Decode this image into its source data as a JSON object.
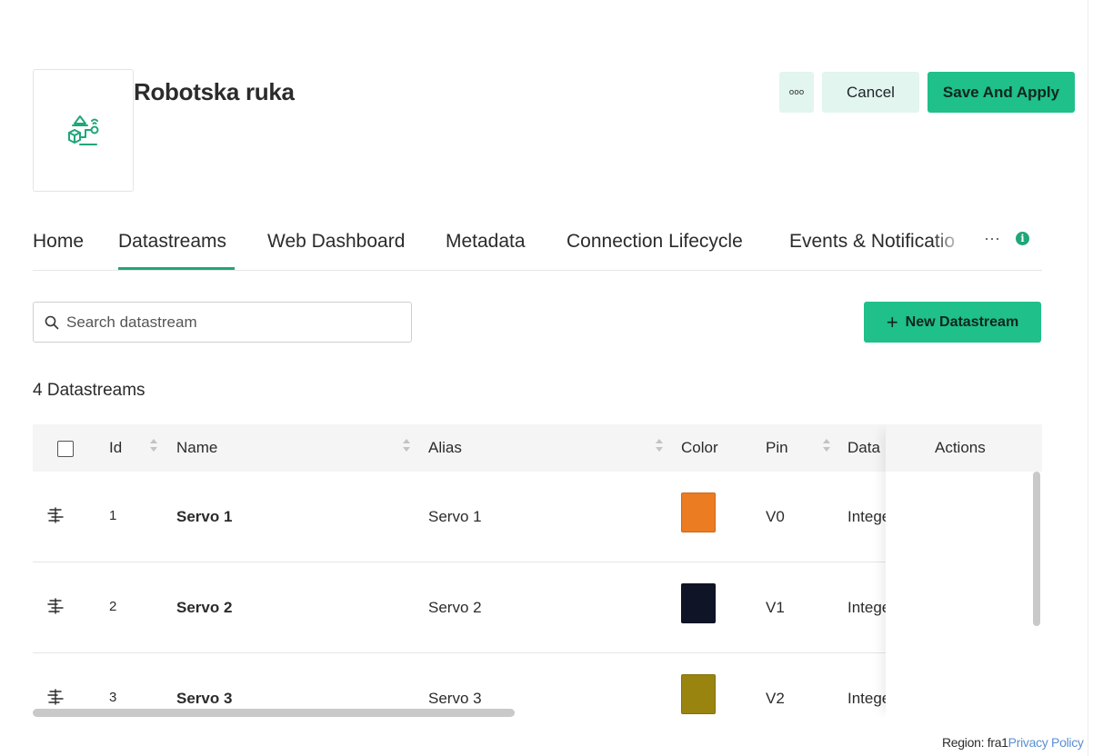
{
  "header": {
    "title": "Robotska ruka",
    "more_label": "ooo",
    "cancel_label": "Cancel",
    "save_label": "Save And Apply"
  },
  "tabs": [
    {
      "label": "Home"
    },
    {
      "label": "Datastreams"
    },
    {
      "label": "Web Dashboard"
    },
    {
      "label": "Metadata"
    },
    {
      "label": "Connection Lifecycle"
    },
    {
      "label": "Events & Notificatio"
    }
  ],
  "tabs_overflow": "···",
  "active_tab": "Datastreams",
  "search": {
    "placeholder": "Search datastream",
    "value": ""
  },
  "new_button": {
    "plus": "+",
    "label": "New Datastream"
  },
  "count_label": "4 Datastreams",
  "table": {
    "columns": {
      "id": "Id",
      "name": "Name",
      "alias": "Alias",
      "color": "Color",
      "pin": "Pin",
      "data": "Data",
      "actions": "Actions"
    },
    "rows": [
      {
        "id": "1",
        "name": "Servo 1",
        "alias": "Servo 1",
        "color": "#ec7c22",
        "pin": "V0",
        "data_type": "Integer"
      },
      {
        "id": "2",
        "name": "Servo 2",
        "alias": "Servo 2",
        "color": "#0f1427",
        "pin": "V1",
        "data_type": "Integer"
      },
      {
        "id": "3",
        "name": "Servo 3",
        "alias": "Servo 3",
        "color": "#9a8410",
        "pin": "V2",
        "data_type": "Integer"
      }
    ]
  },
  "footer": {
    "region": "Region: fra1",
    "privacy": "Privacy Policy"
  },
  "colors": {
    "accent": "#1fc08a",
    "accent_light": "#e2f5ef",
    "tab_underline": "#1fa67a"
  }
}
